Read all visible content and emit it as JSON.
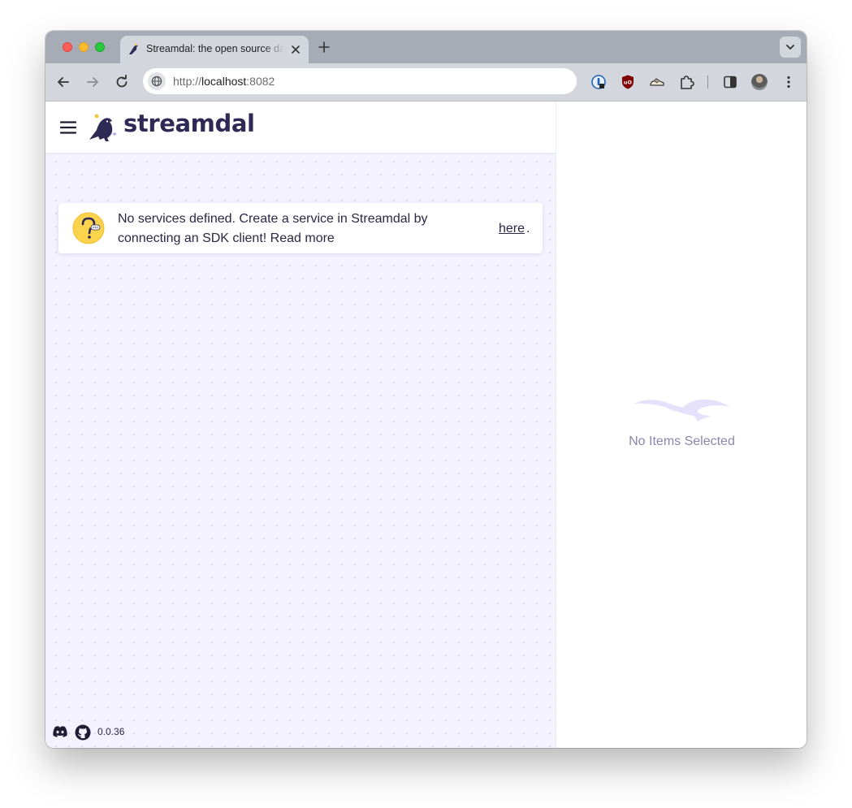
{
  "browser": {
    "tab_title": "Streamdal: the open source data observability",
    "url_scheme": "http://",
    "url_host": "localhost",
    "url_port": ":8082",
    "icons": {
      "back": "back-arrow-icon",
      "forward": "forward-arrow-icon",
      "reload": "reload-icon",
      "site_info": "globe-icon",
      "extensions": [
        "password-manager-icon",
        "ublock-icon",
        "sneaker-extension-icon",
        "puzzle-icon"
      ],
      "side_panel": "side-panel-icon",
      "menu": "kebab-menu-icon"
    }
  },
  "header": {
    "logo_text": "streamdal",
    "menu_icon": "hamburger-icon"
  },
  "notice": {
    "message": "No services defined. Create a service in Streamdal by connecting an SDK client! Read more",
    "link_text": "here",
    "trailing": "."
  },
  "footer": {
    "version": "0.0.36",
    "icons": [
      "discord-icon",
      "github-icon"
    ]
  },
  "details_panel": {
    "empty_text": "No Items Selected"
  },
  "colors": {
    "brand_dark": "#2f2a55",
    "canvas_bg": "#f3f2fe",
    "accent_yellow": "#fcd34d",
    "muted_text": "#8a86ad"
  }
}
